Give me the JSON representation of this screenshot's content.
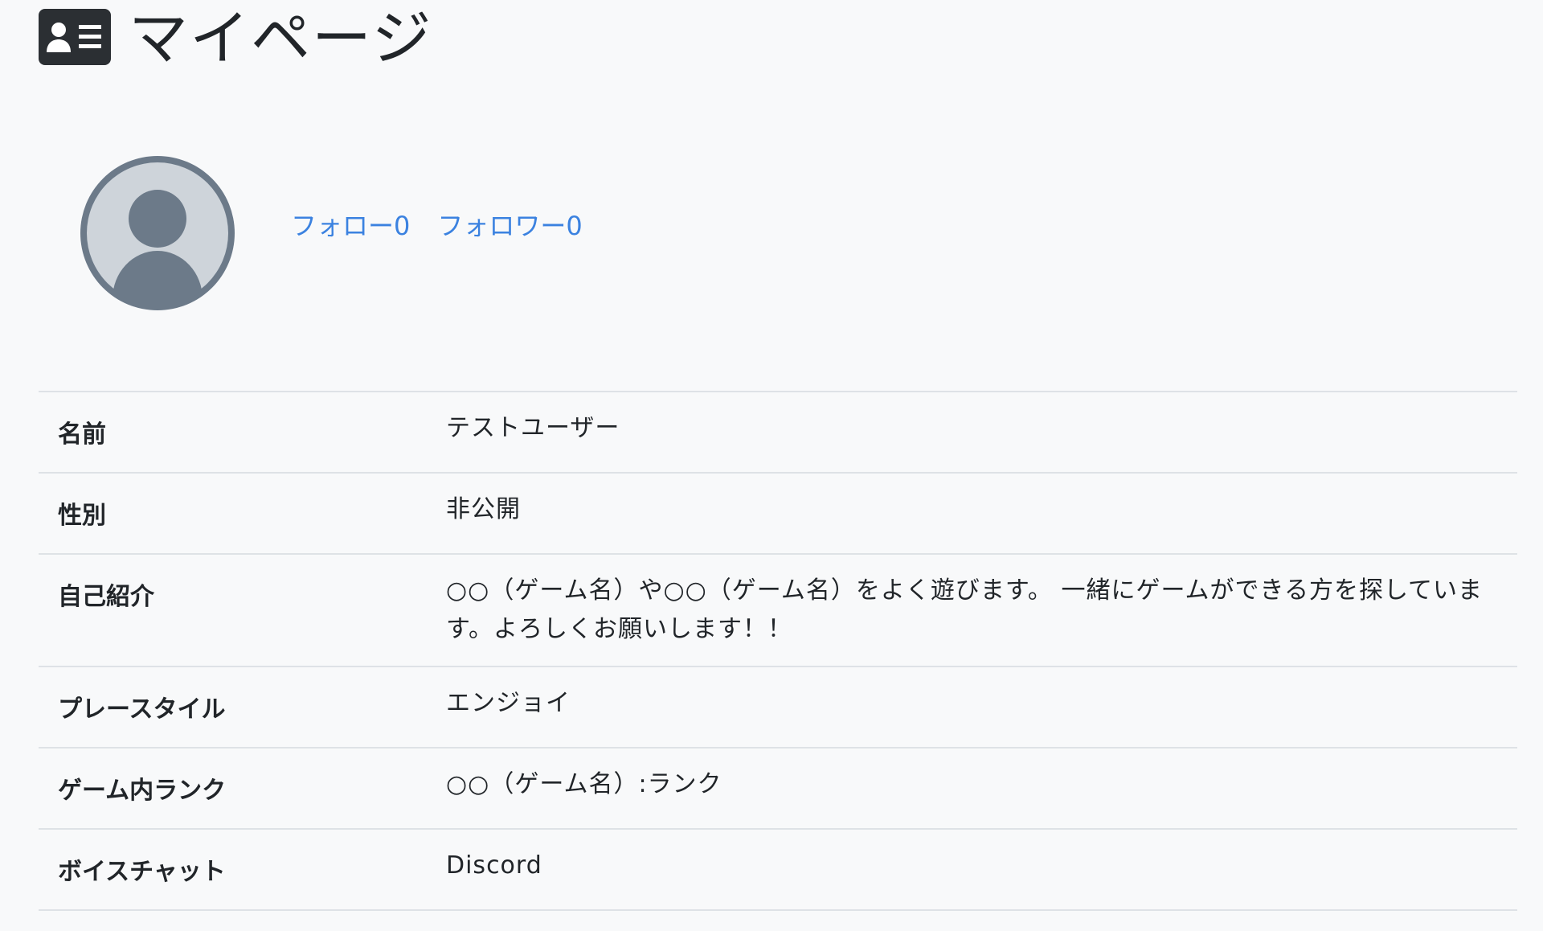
{
  "page": {
    "title": "マイページ",
    "title_icon": "person-vcard-icon"
  },
  "profile": {
    "avatar_icon": "user-avatar-icon",
    "follow_label": "フォロー0",
    "follower_label": "フォロワー0"
  },
  "details": {
    "rows": [
      {
        "label": "名前",
        "value": "テストユーザー"
      },
      {
        "label": "性別",
        "value": "非公開"
      },
      {
        "label": "自己紹介",
        "value": "○○（ゲーム名）や○○（ゲーム名）をよく遊びます。 一緒にゲームができる方を探しています。よろしくお願いします！！"
      },
      {
        "label": "プレースタイル",
        "value": "エンジョイ"
      },
      {
        "label": "ゲーム内ランク",
        "value": "○○（ゲーム名）:ランク"
      },
      {
        "label": "ボイスチャット",
        "value": "Discord"
      }
    ]
  },
  "colors": {
    "background": "#f8f9fa",
    "link": "#3b82e0",
    "text": "#212529",
    "avatar_fill": "#6c7a89",
    "avatar_bg": "#ced4da",
    "divider": "#dee2e6"
  }
}
